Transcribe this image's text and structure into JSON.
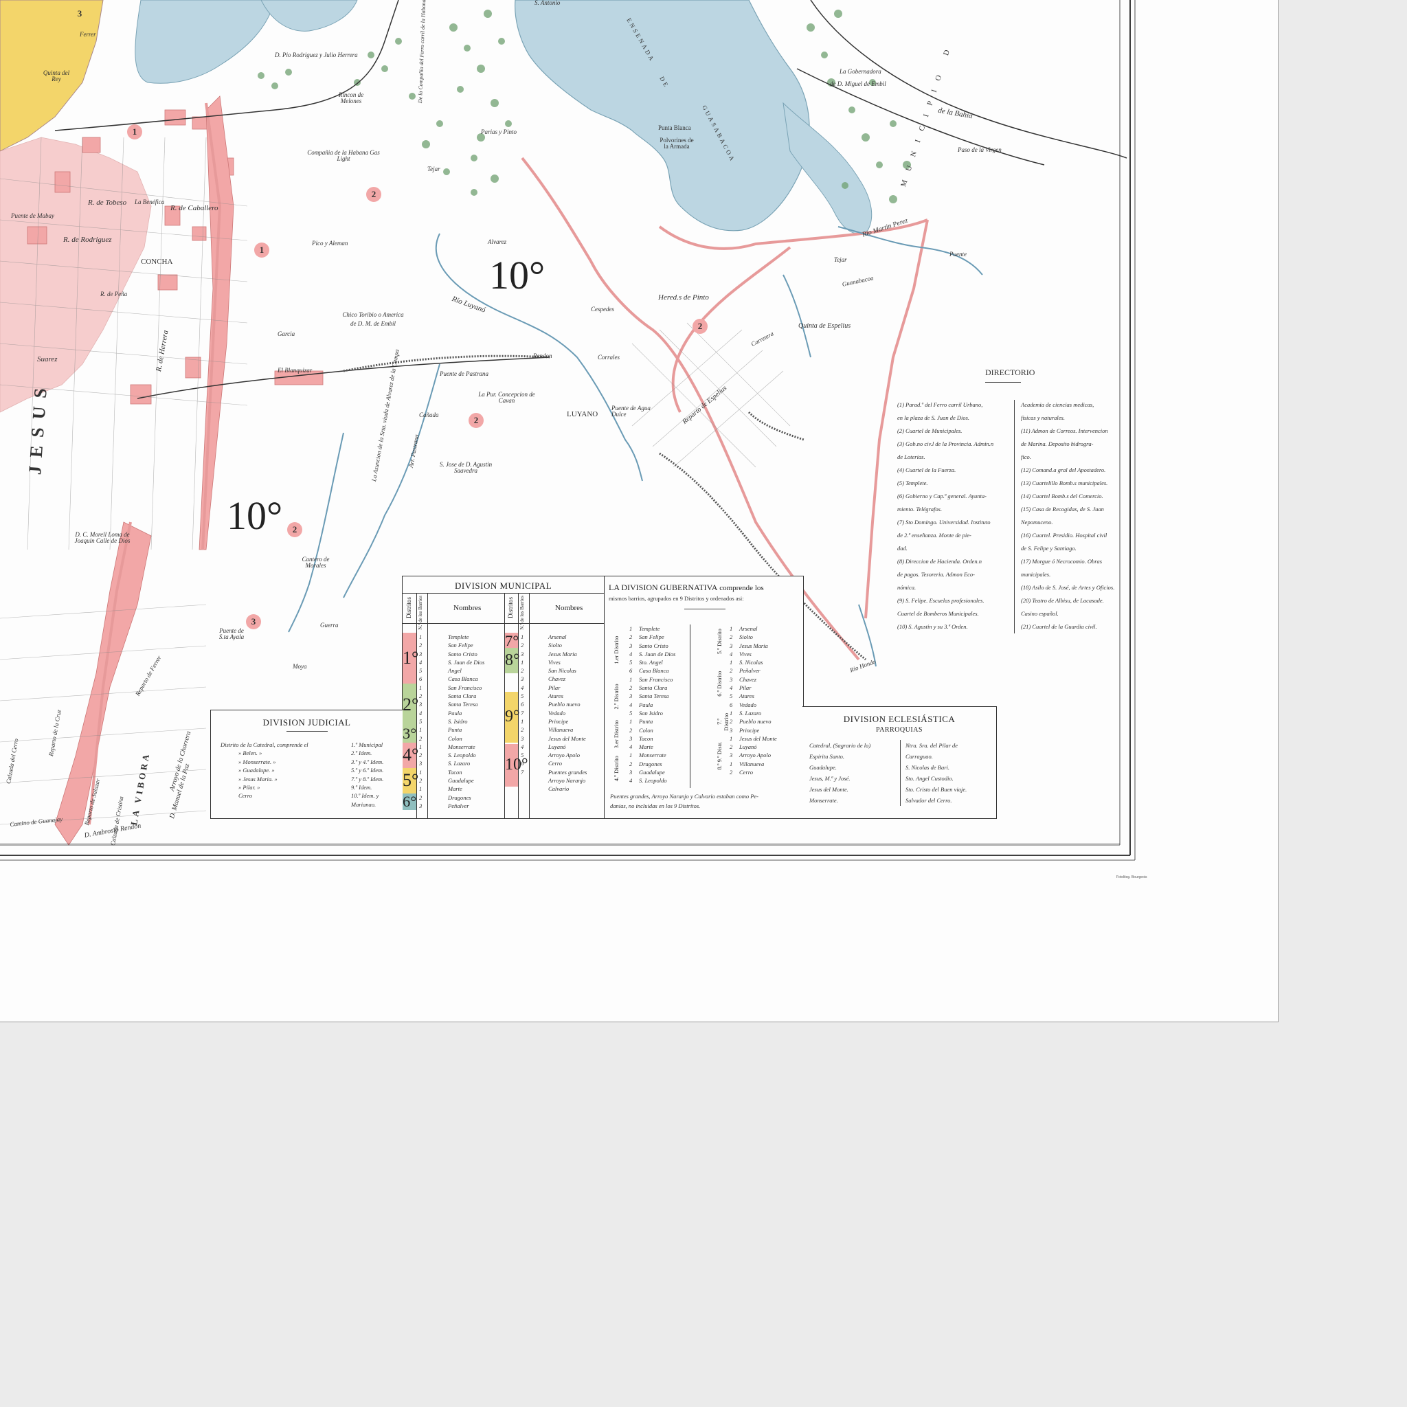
{
  "districts": {
    "d10_a": "10°",
    "d10_b": "10°",
    "concha": "CONCHA",
    "jesus": "JESUS",
    "luyano": "LUYANO",
    "viboras": "LA VIBORA"
  },
  "places": [
    {
      "t": "S. Antonio"
    },
    {
      "t": "ENSENADA"
    },
    {
      "t": "DE"
    },
    {
      "t": "GUASABACOA"
    },
    {
      "t": "MUNICIPIO D"
    },
    {
      "t": "de la Bahia"
    },
    {
      "t": "La Gobernadora"
    },
    {
      "t": "de D. Miguel de Embil"
    },
    {
      "t": "Paso de la Virgen"
    },
    {
      "t": "Punta Blanca"
    },
    {
      "t": "Polvorines de la Armada"
    },
    {
      "t": "Parias y Pinto"
    },
    {
      "t": "Tejar"
    },
    {
      "t": "Compañia de la Habana Gas Light"
    },
    {
      "t": "Rincon de Melones"
    },
    {
      "t": "D. Pio Rodriguez y Julio Herrera"
    },
    {
      "t": "De la Compañia del Ferro carril de la Habana"
    },
    {
      "t": "Quinta del Rey"
    },
    {
      "t": "Ferrer"
    },
    {
      "t": "R. de Tobeso"
    },
    {
      "t": "La Benéfica"
    },
    {
      "t": "R. de Caballero"
    },
    {
      "t": "Puente de Mabay"
    },
    {
      "t": "R. de Rodriguez"
    },
    {
      "t": "R. de Peña"
    },
    {
      "t": "R. de Herrera"
    },
    {
      "t": "Suarez"
    },
    {
      "t": "Pico y Aleman"
    },
    {
      "t": "Alvarez"
    },
    {
      "t": "Rio Luyanó"
    },
    {
      "t": "Cespedes"
    },
    {
      "t": "Hered.s de Pinto"
    },
    {
      "t": "Chico Toribio o America de D. M. de Embil"
    },
    {
      "t": "Garcia"
    },
    {
      "t": "El Blanquizar"
    },
    {
      "t": "Puente de Pastrana"
    },
    {
      "t": "La Pur. Concepcion de Cavan"
    },
    {
      "t": "Rendon"
    },
    {
      "t": "Corrales"
    },
    {
      "t": "Puente de Agua Dulce"
    },
    {
      "t": "Reparto de Espelius"
    },
    {
      "t": "Quinta de Espelius"
    },
    {
      "t": "Carretera"
    },
    {
      "t": "Guanabacoa"
    },
    {
      "t": "Rio Martin Perez"
    },
    {
      "t": "Puente"
    },
    {
      "t": "S. Jose de D. Agustin Saavedra"
    },
    {
      "t": "La Asuncion de la Srta. viuda de Alvarez de la Campa"
    },
    {
      "t": "Arr. Pastrana"
    },
    {
      "t": "Cañada"
    },
    {
      "t": "D. C. Morell Loma de Joaquin Calle de Dios"
    },
    {
      "t": "Cantero de Morales"
    },
    {
      "t": "Puente de S.ta Ayala"
    },
    {
      "t": "Guerra"
    },
    {
      "t": "Moya"
    },
    {
      "t": "Rio Hondo"
    },
    {
      "t": "Calzada de Cristina"
    },
    {
      "t": "Reparto de Salazar"
    },
    {
      "t": "Arroyo de la Chorrera"
    },
    {
      "t": "D. Manuel de la Paz"
    },
    {
      "t": "D. Ambrosio Rendon"
    },
    {
      "t": "Camino de Guanajay"
    },
    {
      "t": "Reparto de Ferrer"
    },
    {
      "t": "Tejar"
    },
    {
      "t": "Reparto de la Cruz"
    },
    {
      "t": "Calzada del Cerro"
    }
  ],
  "zone_numbers": [
    "1",
    "1",
    "2",
    "2",
    "2",
    "2",
    "3",
    "3"
  ],
  "directorio": {
    "title": "DIRECTORIO",
    "left": [
      "(1) Parad.º del Ferro carril Urbano,",
      "en la plaza de S. Juan de Dios.",
      "(2) Cuartel de Municipales.",
      "(3) Gob.no civ.l de la Provincia. Admin.n",
      "de Loterias.",
      "(4) Cuartel de la Fuerza.",
      "(5) Templete.",
      "(6) Gobierno y Cap.ª general. Ayunta-",
      "miento. Telégrafos.",
      "(7) Sto Domingo. Universidad. Instituto",
      "de 2.ª enseñanza. Monte de pie-",
      "dad.",
      "(8) Direccion de Hacienda. Orden.n",
      "de pagos. Tesoreria. Admon Eco-",
      "nómica.",
      "(9) S. Felipe. Escuelas profesionales.",
      "Cuartel de Bomberos Municipales.",
      "(10) S. Agustin y su 3.ª Orden."
    ],
    "right": [
      "Academia de ciencias medicas,",
      "fisicas y naturales.",
      "(11) Admon de Correos. Intervencion",
      "de Marina. Deposito hidrogra-",
      "fico.",
      "(12) Comand.a gral del Apostadero.",
      "(13) Cuartelillo Bomb.s municipales.",
      "(14) Cuartel Bomb.s del Comercio.",
      "(15) Casa de Recogidas, de S. Juan",
      "Nepomuceno.",
      "(16) Cuartel. Presidio. Hospital civil",
      "de S. Felipe y Santiago.",
      "(17) Morgue ó Necrocomio. Obras",
      "municipales.",
      "(18) Asilo de S. José, de Artes y Oficios.",
      "(20) Teatro de Albisu, de Lacasade.",
      "Casino español.",
      "(21) Cuartel de la Guardia civil."
    ]
  },
  "division_municipal": {
    "title": "DIVISION MUNICIPAL",
    "col_distritos": "Distritos",
    "col_barrios": "N.º de los Barrios",
    "col_nombres": "Nombres",
    "left_districts": [
      "1°",
      "2°",
      "3°",
      "4°",
      "5°",
      "6°"
    ],
    "left_colors": [
      "#f2a7a7",
      "#b9d49a",
      "#b9d49a",
      "#f2a7a7",
      "#f3d56a",
      "#8fbfbf"
    ],
    "left_nums": [
      "1",
      "2",
      "3",
      "4",
      "5",
      "6",
      "1",
      "2",
      "3",
      "4",
      "5",
      "1",
      "2",
      "1",
      "2",
      "3",
      "1",
      "2",
      "1",
      "2",
      "3"
    ],
    "left_names": [
      "Templete",
      "San Felipe",
      "Santo Cristo",
      "S. Juan de Dios",
      "Angel",
      "Casa Blanca",
      "San Francisco",
      "Santa Clara",
      "Santa Teresa",
      "Paula",
      "S. Isidro",
      "Punta",
      "Colon",
      "Monserrate",
      "S. Leopoldo",
      "S. Lazaro",
      "Tacon",
      "Guadalupe",
      "Marte",
      "Dragones",
      "Peñalver"
    ],
    "right_districts": [
      "7°",
      "8°",
      "9°",
      "10°"
    ],
    "right_colors": [
      "#f2a7a7",
      "#b9d49a",
      "#f3d56a",
      "#f2a7a7"
    ],
    "right_nums": [
      "1",
      "2",
      "3",
      "1",
      "2",
      "3",
      "4",
      "5",
      "6",
      "7",
      "1",
      "2",
      "3",
      "4",
      "5",
      "6",
      "7"
    ],
    "right_names": [
      "Arsenal",
      "Siolto",
      "Jesus Maria",
      "Vives",
      "San Nicolas",
      "Chavez",
      "Pilar",
      "Atares",
      "Pueblo nuevo",
      "Vedado",
      "Principe",
      "Villanueva",
      "Jesus del Monte",
      "Luyanó",
      "Arroyo Apolo",
      "Cerro",
      "Puentes grandes",
      "Arroyo Naranjo",
      "Calvario"
    ]
  },
  "division_gubernativa": {
    "title": "LA DIVISION GUBERNATIVA",
    "title_rest": "comprende los",
    "subtitle": "mismos barrios, agrupados en 9 Distritos y ordenados asi:",
    "left_districts": [
      "1.er Distrito",
      "2.º Distrito",
      "3.er Distrito",
      "4.º Distrito"
    ],
    "right_districts": [
      "5.º Distrito",
      "6.º Distrito",
      "7.º Distrito",
      "8.º 9.º Distr."
    ],
    "left_nums": [
      "1",
      "2",
      "3",
      "4",
      "5",
      "6",
      "1",
      "2",
      "3",
      "4",
      "5",
      "1",
      "2",
      "3",
      "4",
      "1",
      "2",
      "3",
      "4"
    ],
    "left_names": [
      "Templete",
      "San Felipe",
      "Santo Cristo",
      "S. Juan de Dios",
      "Sto. Angel",
      "Casa Blanca",
      "San Francisco",
      "Santa Clara",
      "Santa Teresa",
      "Paula",
      "San Isidro",
      "Punta",
      "Colon",
      "Tacon",
      "Marte",
      "Monserrate",
      "Dragones",
      "Guadalupe",
      "S. Leopoldo"
    ],
    "right_nums": [
      "1",
      "2",
      "3",
      "4",
      "1",
      "2",
      "3",
      "4",
      "5",
      "6",
      "1",
      "2",
      "3",
      "1",
      "2",
      "3",
      "1",
      "2"
    ],
    "right_names": [
      "Arsenal",
      "Siolto",
      "Jesus Maria",
      "Vives",
      "S. Nicolas",
      "Peñalver",
      "Chavez",
      "Pilar",
      "Atares",
      "Vedado",
      "S. Lazaro",
      "Pueblo nuevo",
      "Principe",
      "Jesus del Monte",
      "Luyanó",
      "Arroyo Apolo",
      "Villanueva",
      "Cerro"
    ],
    "footnote_1": "Puentes grandes, Arroyo Naranjo y Calvario estaban como Pe-",
    "footnote_2": "danias, no incluidas en los 9 Distritos."
  },
  "division_judicial": {
    "title": "DIVISION JUDICIAL",
    "rows": [
      {
        "a": "Distrito de la Catedral, comprende el",
        "b": "1.º Municipal"
      },
      {
        "a": "» Belen. »",
        "b": "2.º Idem."
      },
      {
        "a": "» Monserrate. »",
        "b": "3.º y 4.º Idem."
      },
      {
        "a": "» Guadalupe. »",
        "b": "5.º y 6.º Idem."
      },
      {
        "a": "» Jesus Maria. »",
        "b": "7.º y 8.º Idem."
      },
      {
        "a": "» Pilar. »",
        "b": "9.º Idem."
      },
      {
        "a": "Cerro",
        "b": "10.º Idem. y"
      },
      {
        "a": "",
        "b": "Marianao."
      }
    ]
  },
  "division_eclesiastica": {
    "title": "DIVISION ECLESIÁSTICA",
    "subtitle": "PARROQUIAS",
    "left": [
      "Catedral, (Sagrario de la)",
      "Espiritu Santo.",
      "Guadalupe.",
      "Jesus, M.ª y José.",
      "Jesus del Monte.",
      "Monserrate."
    ],
    "right": [
      "Ntra. Sra. del Pilar de",
      "Carraguao.",
      "S. Nicolas de Bari.",
      "Sto. Angel Custodio.",
      "Sto. Cristo del Buen viaje.",
      "Salvador del Cerro."
    ]
  },
  "printer": "Fotolitog. Bourgeois",
  "colors": {
    "water": "#bcd6e2",
    "urban": "#f2a7a7",
    "green_zone": "#b9d49a",
    "yellow_zone": "#f3d56a",
    "teal_zone": "#8fbfbf",
    "vegetation": "#6fa070"
  }
}
